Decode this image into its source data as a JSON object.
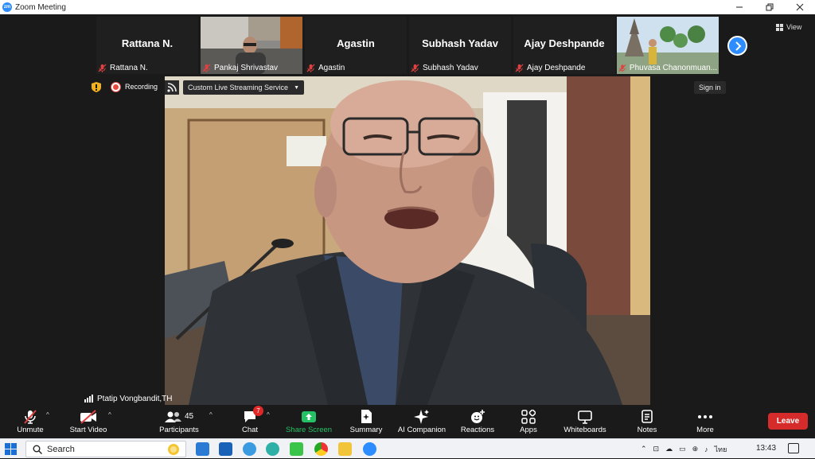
{
  "window": {
    "app_logo": "zm",
    "title": "Zoom Meeting",
    "controls": [
      "minimize-icon",
      "restore-icon",
      "close-icon"
    ]
  },
  "gallery": {
    "tiles": [
      {
        "name": "Rattana N.",
        "label": "Rattana N.",
        "has_video": false
      },
      {
        "name": "",
        "label": "Pankaj Shrivastav",
        "has_video": true
      },
      {
        "name": "Agastin",
        "label": "Agastin",
        "has_video": false
      },
      {
        "name": "Subhash Yadav",
        "label": "Subhash Yadav",
        "has_video": false
      },
      {
        "name": "Ajay Deshpande",
        "label": "Ajay Deshpande",
        "has_video": false
      },
      {
        "name": "",
        "label": "Phuvasa Chanonmuan...",
        "has_video": true
      }
    ],
    "view_label": "View"
  },
  "meeting_info": {
    "recording_label": "Recording",
    "stream_service": "Custom Live Streaming Service",
    "sign_in": "Sign in"
  },
  "main_video": {
    "speaker": "Ptatip Vongbandit,TH"
  },
  "toolbar": {
    "unmute": "Unmute",
    "start_video": "Start Video",
    "participants": "Participants",
    "participant_count": "45",
    "chat": "Chat",
    "chat_badge": "7",
    "share_screen": "Share Screen",
    "summary": "Summary",
    "ai_companion": "AI Companion",
    "reactions": "Reactions",
    "apps": "Apps",
    "whiteboards": "Whiteboards",
    "notes": "Notes",
    "more": "More",
    "leave": "Leave",
    "share_color": "#24c264",
    "leave_color": "#d62b2b"
  },
  "taskbar": {
    "search_label": "Search",
    "language": "ไทย",
    "time": "13:43"
  }
}
